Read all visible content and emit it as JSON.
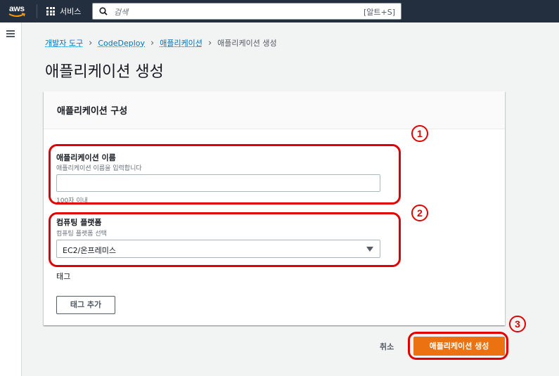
{
  "topnav": {
    "logo": "aws",
    "services_label": "서비스",
    "search_placeholder": "검색",
    "search_shortcut": "[알트+S]"
  },
  "breadcrumb": [
    {
      "label": "개발자 도구",
      "link": true
    },
    {
      "label": "CodeDeploy",
      "link": true
    },
    {
      "label": "애플리케이션",
      "link": true
    },
    {
      "label": "애플리케이션 생성",
      "link": false
    }
  ],
  "page_title": "애플리케이션 생성",
  "panel": {
    "title": "애플리케이션 구성",
    "app_name": {
      "label": "애플리케이션 이름",
      "description": "애플리케이션 이름을 입력합니다",
      "value": "",
      "constraint": "100자 이내"
    },
    "platform": {
      "label": "컴퓨팅 플랫폼",
      "description": "컴퓨팅 플랫폼 선택",
      "selected": "EC2/온프레미스"
    },
    "tags": {
      "label": "태그",
      "add_button": "태그 추가"
    }
  },
  "actions": {
    "cancel": "취소",
    "create": "애플리케이션 생성"
  },
  "annotations": {
    "n1": "1",
    "n2": "2",
    "n3": "3",
    "color": "#e00000"
  },
  "colors": {
    "nav_bg": "#232f3e",
    "primary": "#ec7211",
    "link": "#0073bb"
  }
}
